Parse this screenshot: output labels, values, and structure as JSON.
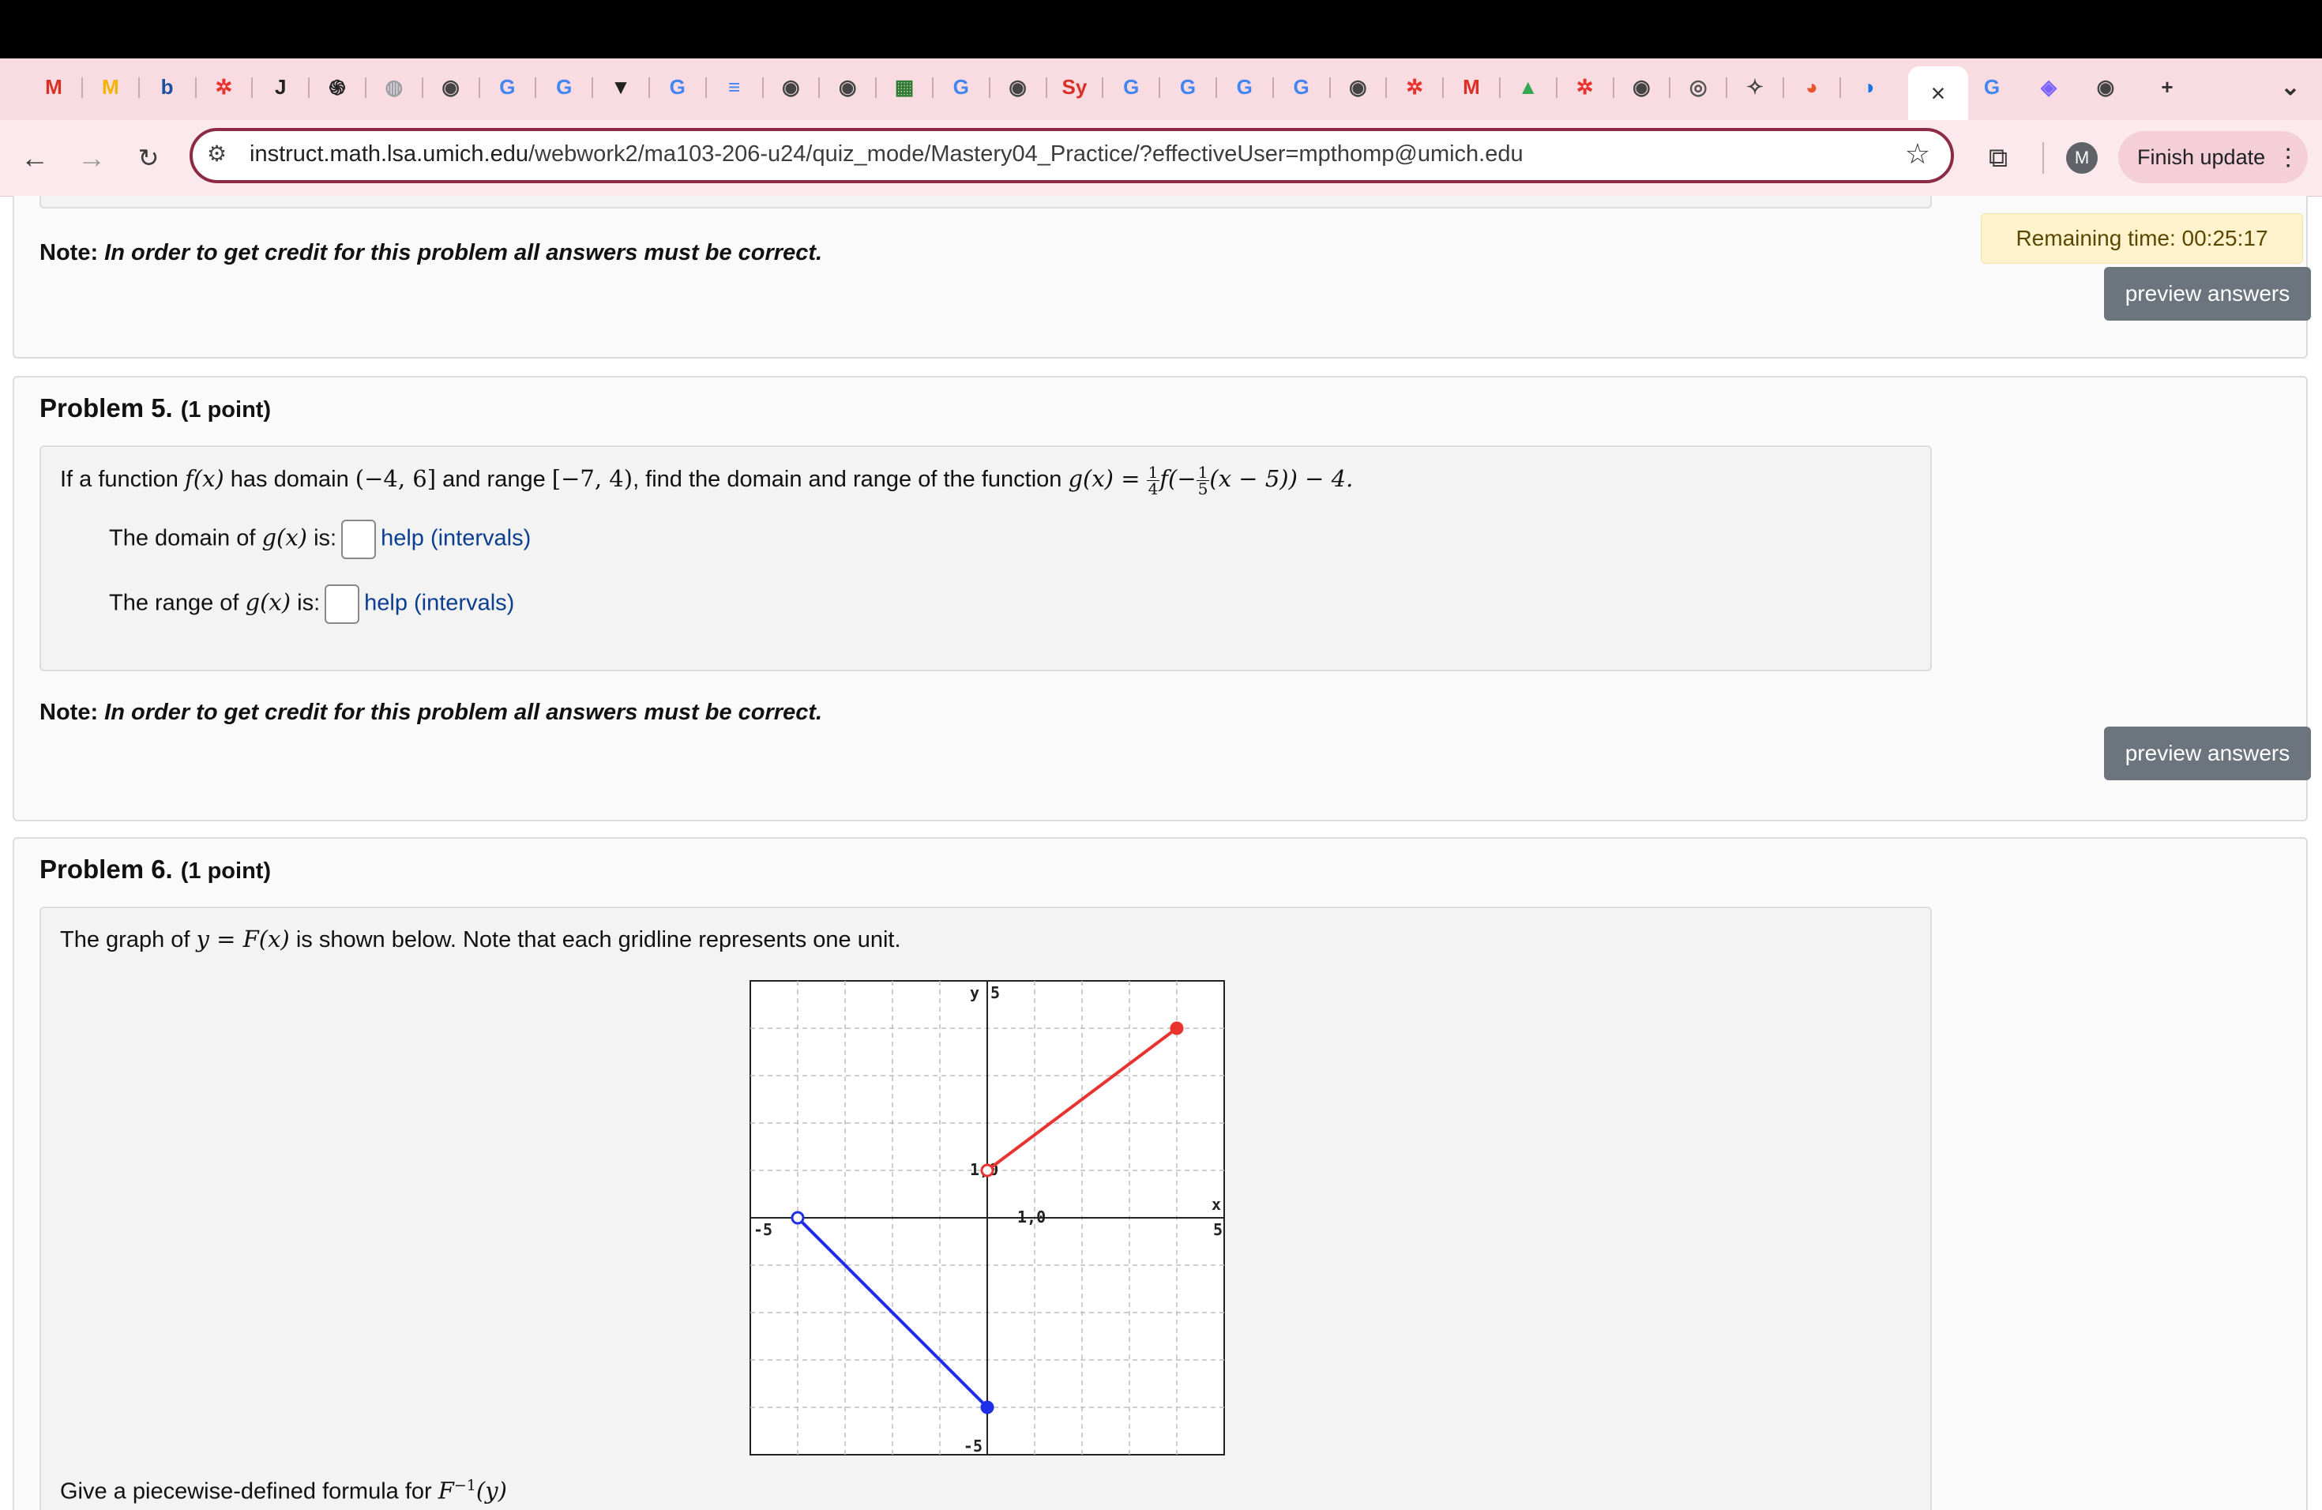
{
  "browser": {
    "url_host": "instruct.math.lsa.umich.edu",
    "url_path": "/webwork2/ma103-206-u24/quiz_mode/Mastery04_Practice/?effectiveUser=mpthomp@umich.edu",
    "finish_update_label": "Finish update",
    "avatar_initial": "M",
    "tabs": [
      "M",
      "M",
      "b",
      "✲",
      "J",
      "֍",
      "◍",
      "◉",
      "G",
      "G",
      "▼",
      "G",
      "≡",
      "◉",
      "◉",
      "▦",
      "G",
      "◉",
      "Sy",
      "G",
      "G",
      "G",
      "G",
      "◉",
      "✲",
      "M",
      "▲",
      "✲",
      "◉",
      "◎",
      "✧",
      "◕",
      "◑"
    ],
    "tabs_after": [
      "G",
      "◈",
      "◉"
    ],
    "active_tab_close": "×",
    "new_tab": "+",
    "tab_menu": "⌄"
  },
  "timer": {
    "label": "Remaining time: 00:25:17"
  },
  "problem4": {
    "note_prefix": "Note:",
    "note_text": "In order to get credit for this problem all answers must be correct.",
    "preview_label": "preview answers"
  },
  "problem5": {
    "title": "Problem 5.",
    "points": "(1 point)",
    "intro_a": "If a function",
    "fx": "f(x)",
    "has_domain": "has domain",
    "domain": "(−4, 6]",
    "and_range": "and range",
    "range": "[−7, 4)",
    "find_text": ", find the domain and range of the function",
    "g_def_lhs": "g(x) =",
    "g_def_frac1_num": "1",
    "g_def_frac1_den": "4",
    "g_def_mid": "f(−",
    "g_def_frac2_num": "1",
    "g_def_frac2_den": "5",
    "g_def_tail": "(x − 5)) − 4.",
    "domain_label_a": "The domain of",
    "gx": "g(x)",
    "is_label": "is:",
    "range_label_a": "The range of",
    "help_intervals": "help (intervals)",
    "note_prefix": "Note:",
    "note_text": "In order to get credit for this problem all answers must be correct.",
    "preview_label": "preview answers"
  },
  "problem6": {
    "title": "Problem 6.",
    "points": "(1 point)",
    "intro_a": "The graph of",
    "y_eq": "y = F(x)",
    "intro_b": "is shown below. Note that each gridline represents one unit.",
    "give_text": "Give a piecewise-defined formula for",
    "finv": "F",
    "finv_sup": "−1",
    "finv_arg": "(y)"
  },
  "chart_data": {
    "type": "line",
    "title": "",
    "xlabel": "x",
    "ylabel": "y",
    "xlim": [
      -5,
      5
    ],
    "ylim": [
      -5,
      5
    ],
    "tick_labels": {
      "x_min": "-5",
      "x_max": "5",
      "y_min": "-5",
      "y_max": "5",
      "x_one": "1,0",
      "y_one": "1,0"
    },
    "grid": true,
    "series": [
      {
        "color": "#e8332e",
        "points": [
          [
            0,
            1
          ],
          [
            4,
            4
          ]
        ],
        "start_open": true,
        "end_closed": true
      },
      {
        "color": "#1f2ee8",
        "points": [
          [
            -4,
            0
          ],
          [
            0,
            -4
          ]
        ],
        "start_open": true,
        "end_closed": true
      }
    ]
  }
}
